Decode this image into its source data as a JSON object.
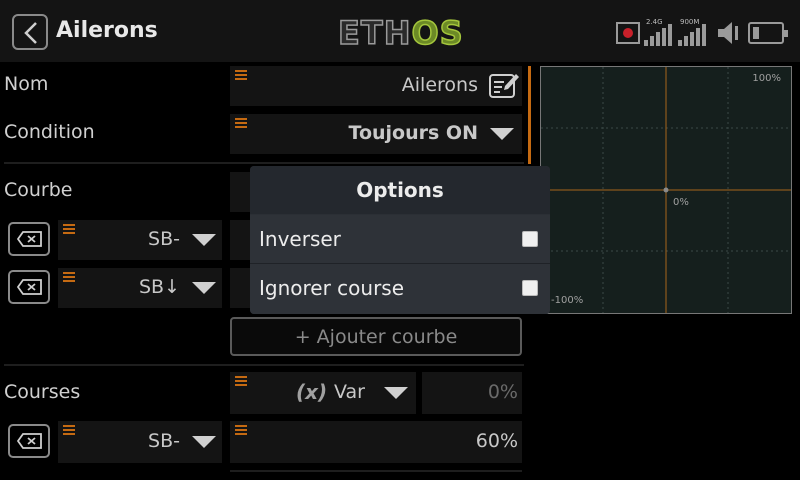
{
  "header": {
    "title": "Ailerons",
    "logo_left": "ETH",
    "logo_right": "OS",
    "signal_24": "2.4G",
    "signal_900": "900M"
  },
  "rows": {
    "nom_label": "Nom",
    "nom_value": "Ailerons",
    "condition_label": "Condition",
    "condition_value": "Toujours ON",
    "courbe_label": "Courbe",
    "curve1_source": "SB-",
    "curve2_source": "SB↓",
    "add_curve": "+ Ajouter courbe",
    "courses_label": "Courses",
    "courses_var_icon": "(x)",
    "courses_var": "Var",
    "courses_value": "0%",
    "course1_source": "SB-",
    "course1_value": "60%"
  },
  "graph": {
    "top_right": "100%",
    "center": "0%",
    "bottom_left": "-100%"
  },
  "dialog": {
    "title": "Options",
    "inverser": "Inverser",
    "ignorer": "Ignorer course"
  },
  "colors": {
    "accent": "#c56a12",
    "graph_bg": "#151f1d",
    "dialog_bg": "#2b2f35",
    "logo_green": "#a4c63c"
  }
}
